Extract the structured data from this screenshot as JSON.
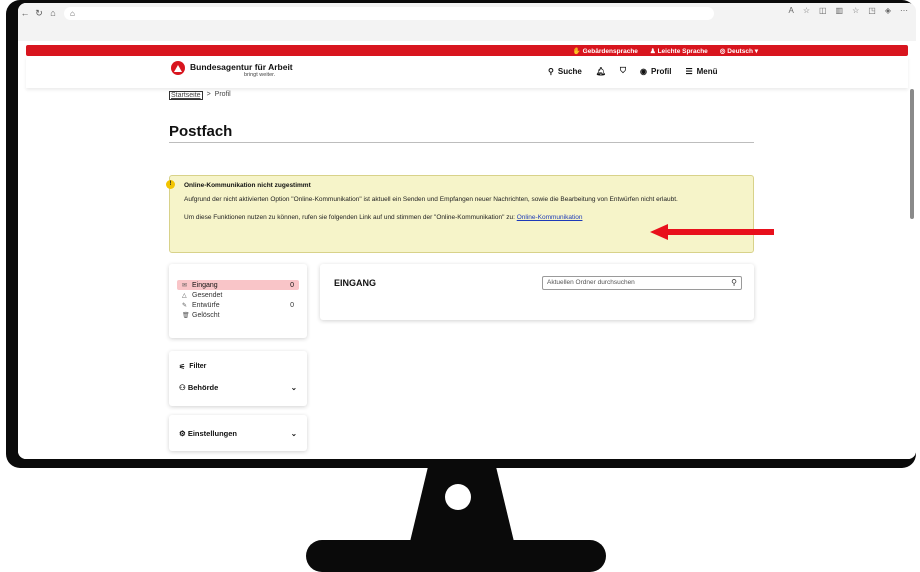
{
  "browser": {
    "nav": [
      "←",
      "↻",
      "⌂",
      "⌂"
    ]
  },
  "topbar": {
    "sign_language": "Gebärdensprache",
    "easy_language": "Leichte Sprache",
    "language": "Deutsch"
  },
  "header": {
    "brand": "Bundesagentur für Arbeit",
    "tagline": "bringt weiter.",
    "search": "Suche",
    "profile": "Profil",
    "menu": "Menü"
  },
  "breadcrumb": {
    "home": "Startseite",
    "separator": ">",
    "current": "Profil"
  },
  "page": {
    "title": "Postfach"
  },
  "notice": {
    "title": "Online-Kommunikation nicht zugestimmt",
    "text1": "Aufgrund der nicht aktivierten Option \"Online-Kommunikation\" ist aktuell ein Senden und Empfangen neuer Nachrichten, sowie die Bearbeitung von Entwürfen nicht erlaubt.",
    "text2": "Um diese Funktionen nutzen zu können, rufen sie folgenden Link auf und stimmen der \"Online-Kommunikation\" zu:",
    "link": "Online-Kommunikation"
  },
  "folders": [
    {
      "label": "Eingang",
      "count": "0",
      "icon": "inbox-icon"
    },
    {
      "label": "Gesendet",
      "count": "",
      "icon": "send-icon"
    },
    {
      "label": "Entwürfe",
      "count": "0",
      "icon": "draft-icon"
    },
    {
      "label": "Gelöscht",
      "count": "",
      "icon": "trash-icon"
    }
  ],
  "filter": {
    "title": "Filter",
    "authority": "Behörde"
  },
  "settings": {
    "label": "Einstellungen"
  },
  "inbox": {
    "title": "EINGANG",
    "search_placeholder": "Aktuellen Ordner durchsuchen"
  },
  "colors": {
    "brand_red": "#d8151e",
    "notice_bg": "#f6f4c9",
    "active_folder": "#f9c5c8",
    "link": "#1d3ab8"
  }
}
